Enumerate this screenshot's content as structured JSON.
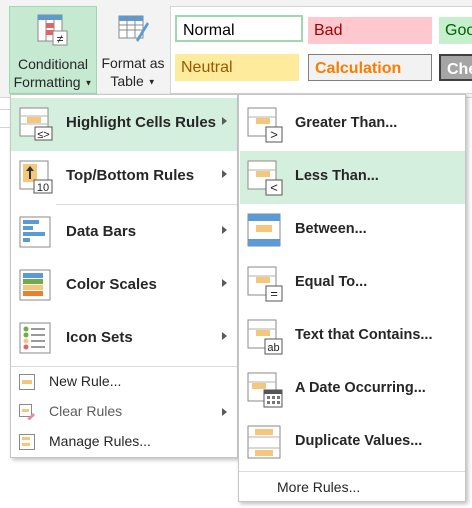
{
  "ribbon": {
    "conditional_formatting": {
      "line1": "Conditional",
      "line2": "Formatting"
    },
    "format_as_table": {
      "line1": "Format as",
      "line2": "Table"
    },
    "styles": {
      "normal": "Normal",
      "bad": "Bad",
      "good": "Good",
      "neutral": "Neutral",
      "calculation": "Calculation",
      "check_cell": "Check Cell"
    }
  },
  "main_menu": {
    "items": [
      {
        "label": "Highlight Cells Rules",
        "icon": "highlight-cells-icon",
        "highlighted": true
      },
      {
        "label": "Top/Bottom Rules",
        "icon": "top-bottom-icon"
      },
      {
        "label": "Data Bars",
        "icon": "data-bars-icon"
      },
      {
        "label": "Color Scales",
        "icon": "color-scales-icon"
      },
      {
        "label": "Icon Sets",
        "icon": "icon-sets-icon"
      }
    ],
    "small_items": [
      {
        "label": "New Rule...",
        "icon": "new-rule-icon"
      },
      {
        "label": "Clear Rules",
        "icon": "clear-rules-icon"
      },
      {
        "label": "Manage Rules...",
        "icon": "manage-rules-icon"
      }
    ]
  },
  "sub_menu": {
    "items": [
      {
        "label": "Greater Than...",
        "icon": "greater-than-icon"
      },
      {
        "label": "Less Than...",
        "icon": "less-than-icon",
        "highlighted": true
      },
      {
        "label": "Between...",
        "icon": "between-icon"
      },
      {
        "label": "Equal To...",
        "icon": "equal-to-icon"
      },
      {
        "label": "Text that Contains...",
        "icon": "text-contains-icon"
      },
      {
        "label": "A Date Occurring...",
        "icon": "date-occurring-icon"
      },
      {
        "label": "Duplicate Values...",
        "icon": "duplicate-values-icon"
      }
    ],
    "more_rules": "More Rules..."
  },
  "colors": {
    "highlight": "#d5efdf",
    "accent_green": "#217346",
    "rule_fill": "#f4c77d"
  }
}
